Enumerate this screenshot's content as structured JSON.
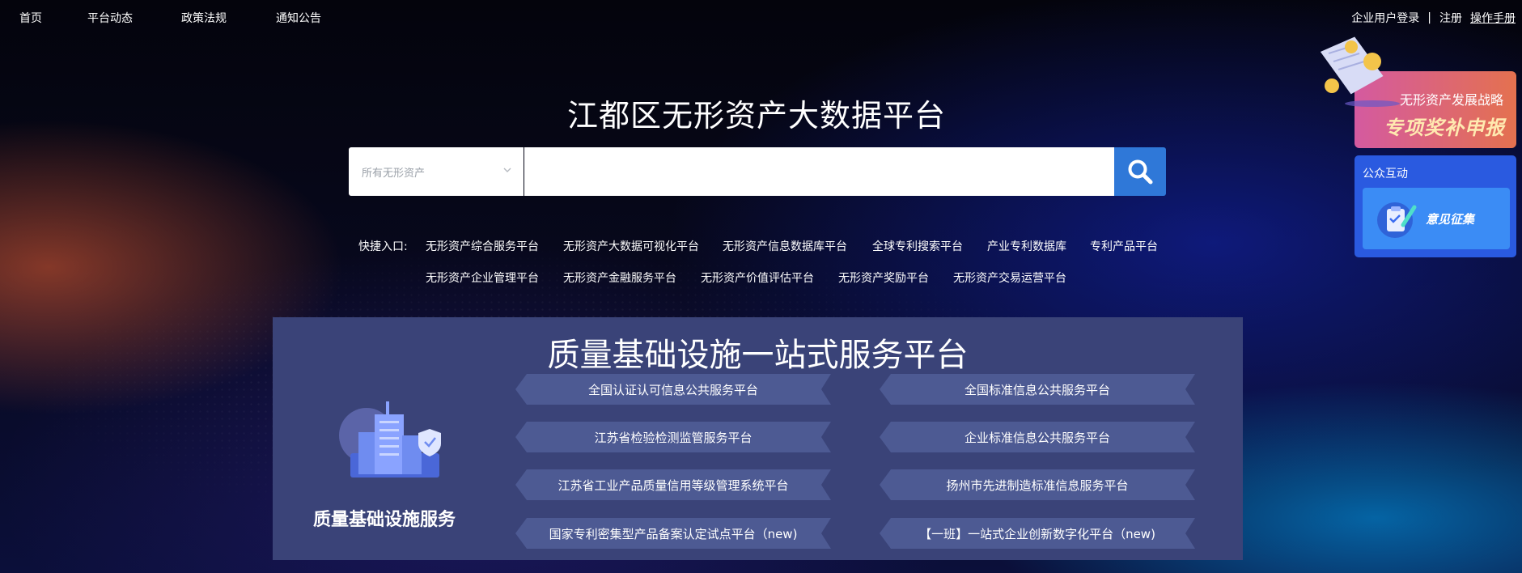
{
  "nav": {
    "items": [
      "首页",
      "平台动态",
      "政策法规",
      "通知公告"
    ],
    "login": "企业用户登录",
    "separator": "|",
    "register": "注册",
    "manual": "操作手册"
  },
  "site_title": "江都区无形资产大数据平台",
  "search": {
    "category_selected": "所有无形资产",
    "query_value": "",
    "button_icon": "search-icon"
  },
  "quick_entry": {
    "label": "快捷入口:",
    "row1": [
      "无形资产综合服务平台",
      "无形资产大数据可视化平台",
      "无形资产信息数据库平台",
      "全球专利搜索平台",
      "产业专利数据库",
      "专利产品平台"
    ],
    "row2": [
      "无形资产企业管理平台",
      "无形资产金融服务平台",
      "无形资产价值评估平台",
      "无形资产奖励平台",
      "无形资产交易运营平台"
    ]
  },
  "quality": {
    "title": "质量基础设施一站式服务平台",
    "subtitle": "质量基础设施服务",
    "links_left": [
      "全国认证认可信息公共服务平台",
      "江苏省检验检测监管服务平台",
      "江苏省工业产品质量信用等级管理系统平台",
      "国家专利密集型产品备案认定试点平台（new)"
    ],
    "links_right": [
      "全国标准信息公共服务平台",
      "企业标准信息公共服务平台",
      "扬州市先进制造标准信息服务平台",
      "【一班】一站式企业创新数字化平台（new)"
    ]
  },
  "promo": {
    "line1": "无形资产发展战略",
    "line2": "专项奖补申报"
  },
  "interaction": {
    "heading": "公众互动",
    "card_label": "意见征集"
  },
  "colors": {
    "search_button": "#2f78d8",
    "panel_bg": "#3a4378",
    "link_bg": "#4d5a93",
    "interaction_bg": "#2a5ae0"
  }
}
